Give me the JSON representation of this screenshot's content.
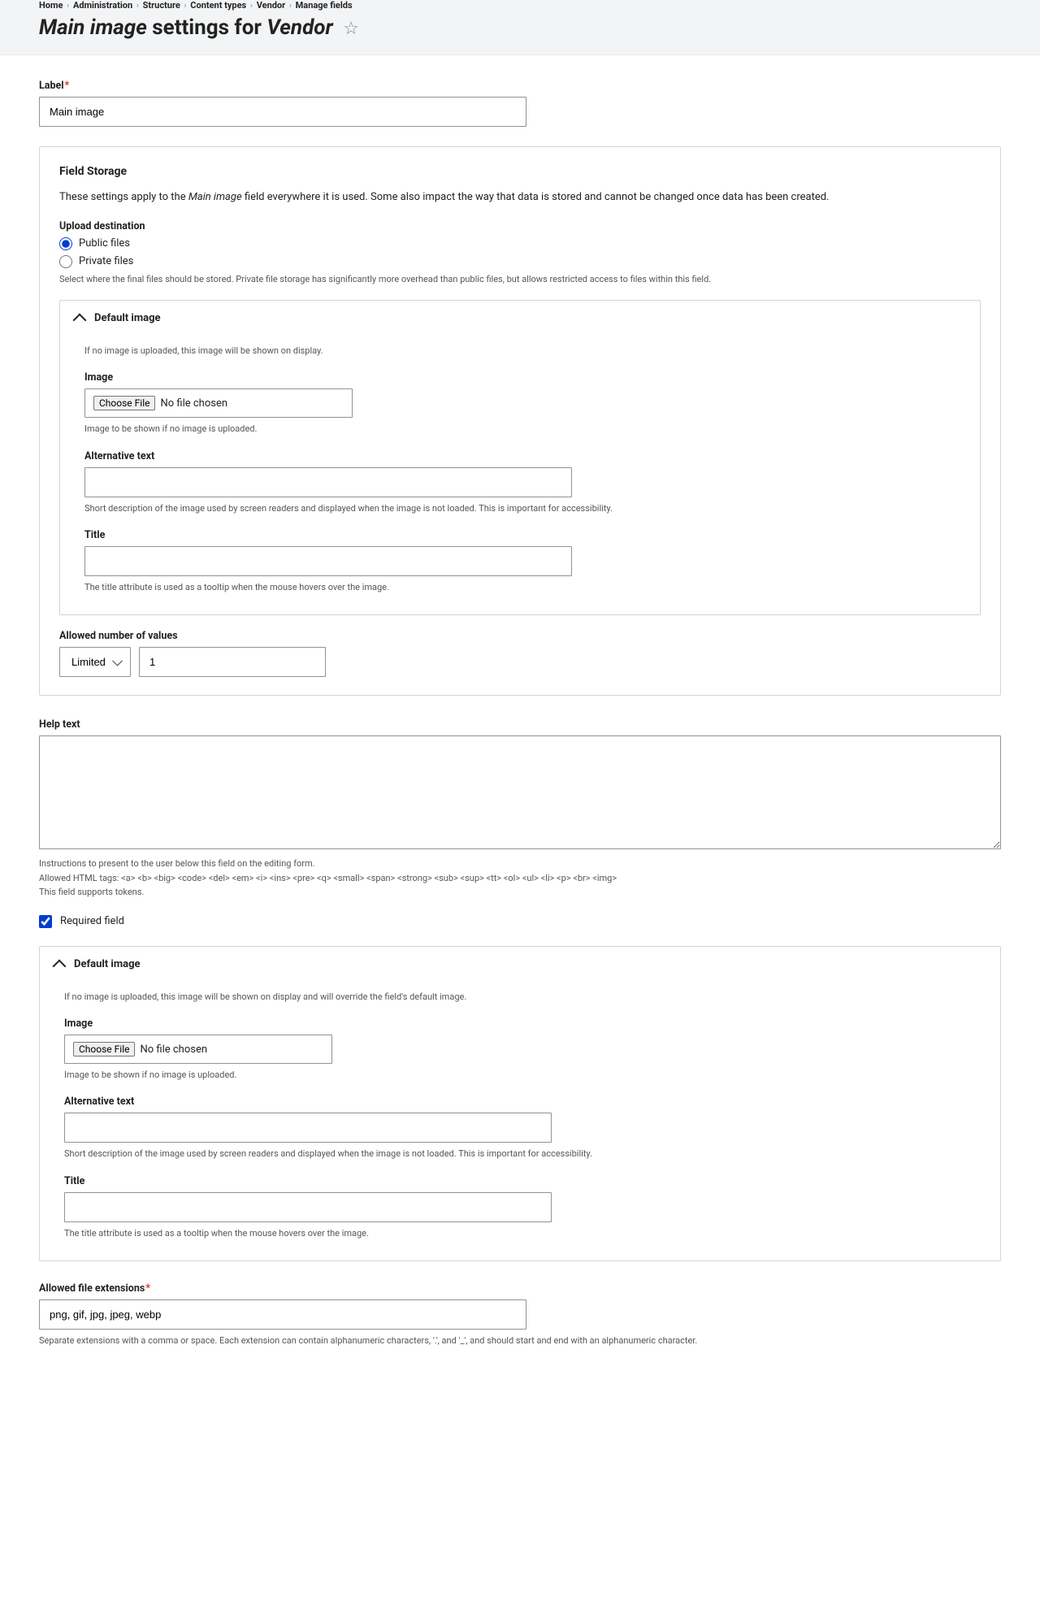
{
  "breadcrumb": {
    "items": [
      "Home",
      "Administration",
      "Structure",
      "Content types",
      "Vendor",
      "Manage fields"
    ]
  },
  "heading": {
    "prefix": "Main image",
    "middle": " settings for ",
    "suffix": "Vendor"
  },
  "label": {
    "title": "Label",
    "value": "Main image"
  },
  "field_storage": {
    "title": "Field Storage",
    "desc_prefix": "These settings apply to the ",
    "desc_em": "Main image",
    "desc_suffix": " field everywhere it is used. Some also impact the way that data is stored and cannot be changed once data has been created.",
    "upload_destination_label": "Upload destination",
    "public_label": "Public files",
    "private_label": "Private files",
    "upload_help": "Select where the final files should be stored. Private file storage has significantly more overhead than public files, but allows restricted access to files within this field.",
    "default_image": {
      "summary": "Default image",
      "intro": "If no image is uploaded, this image will be shown on display.",
      "image_label": "Image",
      "choose_file_btn": "Choose File",
      "no_file": "No file chosen",
      "image_help": "Image to be shown if no image is uploaded.",
      "alt_label": "Alternative text",
      "alt_help": "Short description of the image used by screen readers and displayed when the image is not loaded. This is important for accessibility.",
      "title_label": "Title",
      "title_help": "The title attribute is used as a tooltip when the mouse hovers over the image."
    },
    "allowed_values": {
      "label": "Allowed number of values",
      "select": "Limited",
      "number": "1"
    }
  },
  "help_text": {
    "label": "Help text",
    "desc1": "Instructions to present to the user below this field on the editing form.",
    "desc2": "Allowed HTML tags: <a> <b> <big> <code> <del> <em> <i> <ins> <pre> <q> <small> <span> <strong> <sub> <sup> <tt> <ol> <ul> <li> <p> <br> <img>",
    "desc3": "This field supports tokens."
  },
  "required": {
    "label": "Required field"
  },
  "default_image2": {
    "summary": "Default image",
    "intro": "If no image is uploaded, this image will be shown on display and will override the field's default image.",
    "image_label": "Image",
    "choose_file_btn": "Choose File",
    "no_file": "No file chosen",
    "image_help": "Image to be shown if no image is uploaded.",
    "alt_label": "Alternative text",
    "alt_help": "Short description of the image used by screen readers and displayed when the image is not loaded. This is important for accessibility.",
    "title_label": "Title",
    "title_help": "The title attribute is used as a tooltip when the mouse hovers over the image."
  },
  "extensions": {
    "label": "Allowed file extensions",
    "value": "png, gif, jpg, jpeg, webp",
    "help": "Separate extensions with a comma or space. Each extension can contain alphanumeric characters, '.', and '_', and should start and end with an alphanumeric character."
  }
}
